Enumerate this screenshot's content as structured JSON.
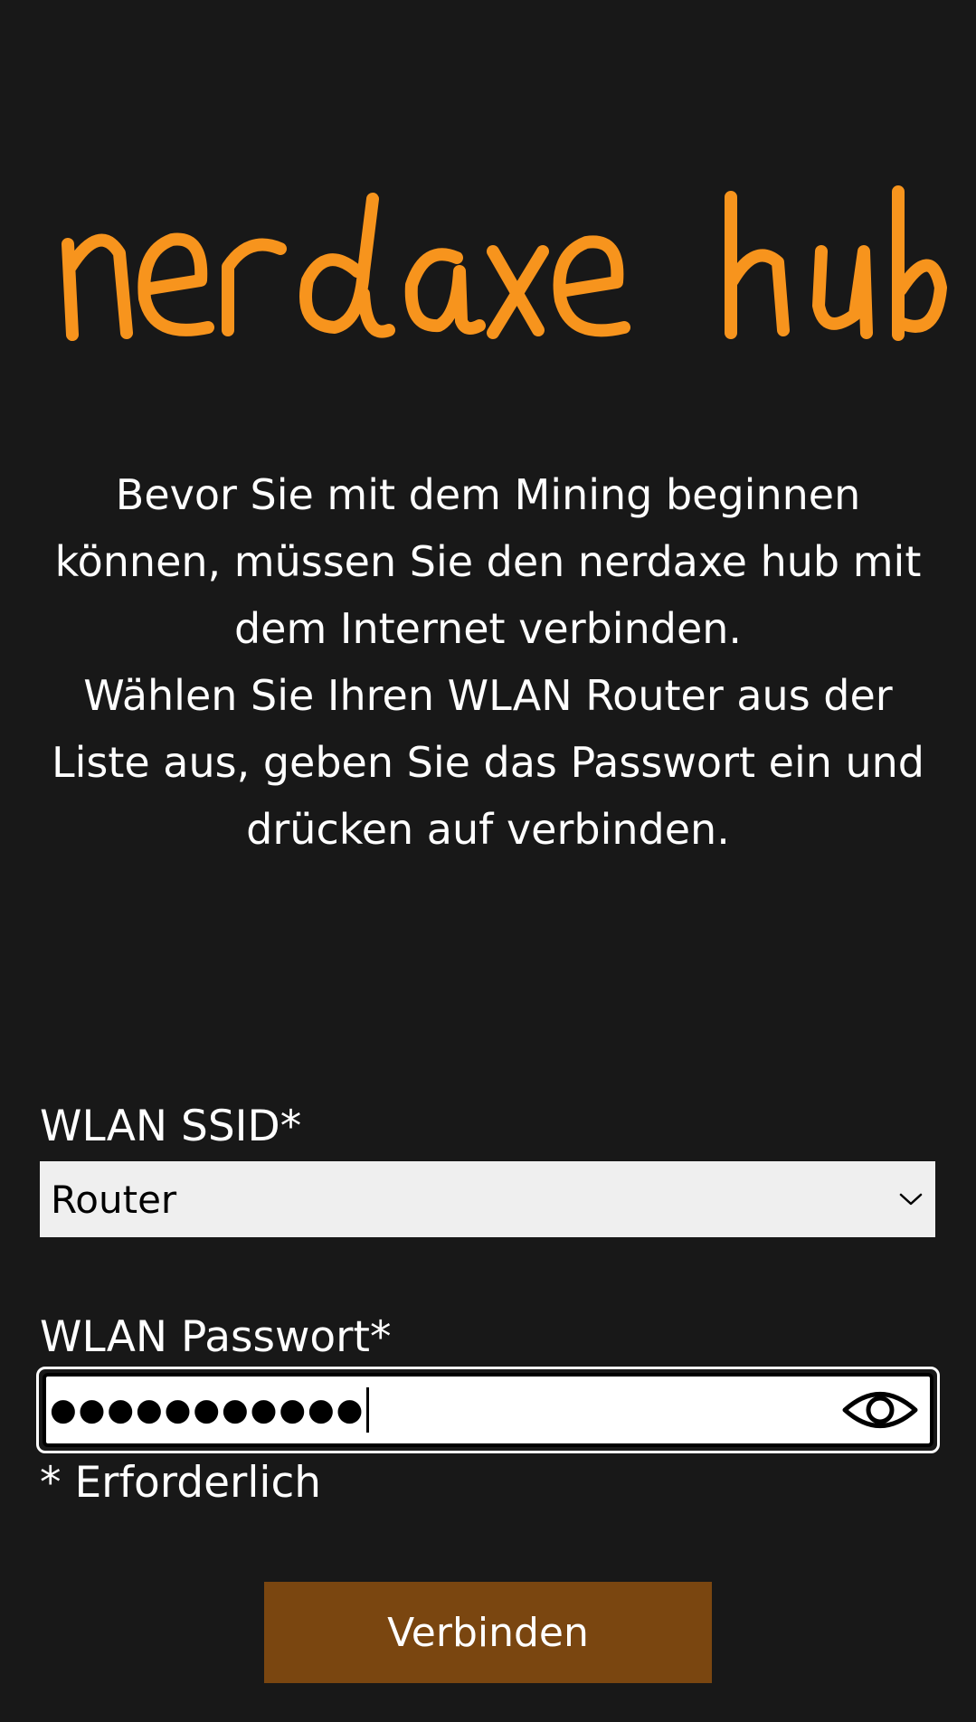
{
  "brand": {
    "logo_text": "nerdaxe hub",
    "color": "#f7941d"
  },
  "intro": {
    "line1": "Bevor Sie mit dem Mining beginnen können, müssen Sie den nerdaxe hub mit dem Internet verbinden.",
    "line2": "Wählen Sie Ihren WLAN Router aus der Liste aus, geben Sie das Passwort ein und drücken auf verbinden."
  },
  "form": {
    "ssid_label": "WLAN SSID*",
    "ssid_value": "Router",
    "password_label": "WLAN Passwort*",
    "password_masked": "●●●●●●●●●●●",
    "required_hint": "* Erforderlich",
    "submit_label": "Verbinden"
  },
  "icons": {
    "select": "chevron-down-icon",
    "password_toggle": "eye-icon"
  },
  "colors": {
    "background": "#181818",
    "accent": "#f7941d",
    "button": "#7a4610",
    "select_bg": "#efefef"
  }
}
